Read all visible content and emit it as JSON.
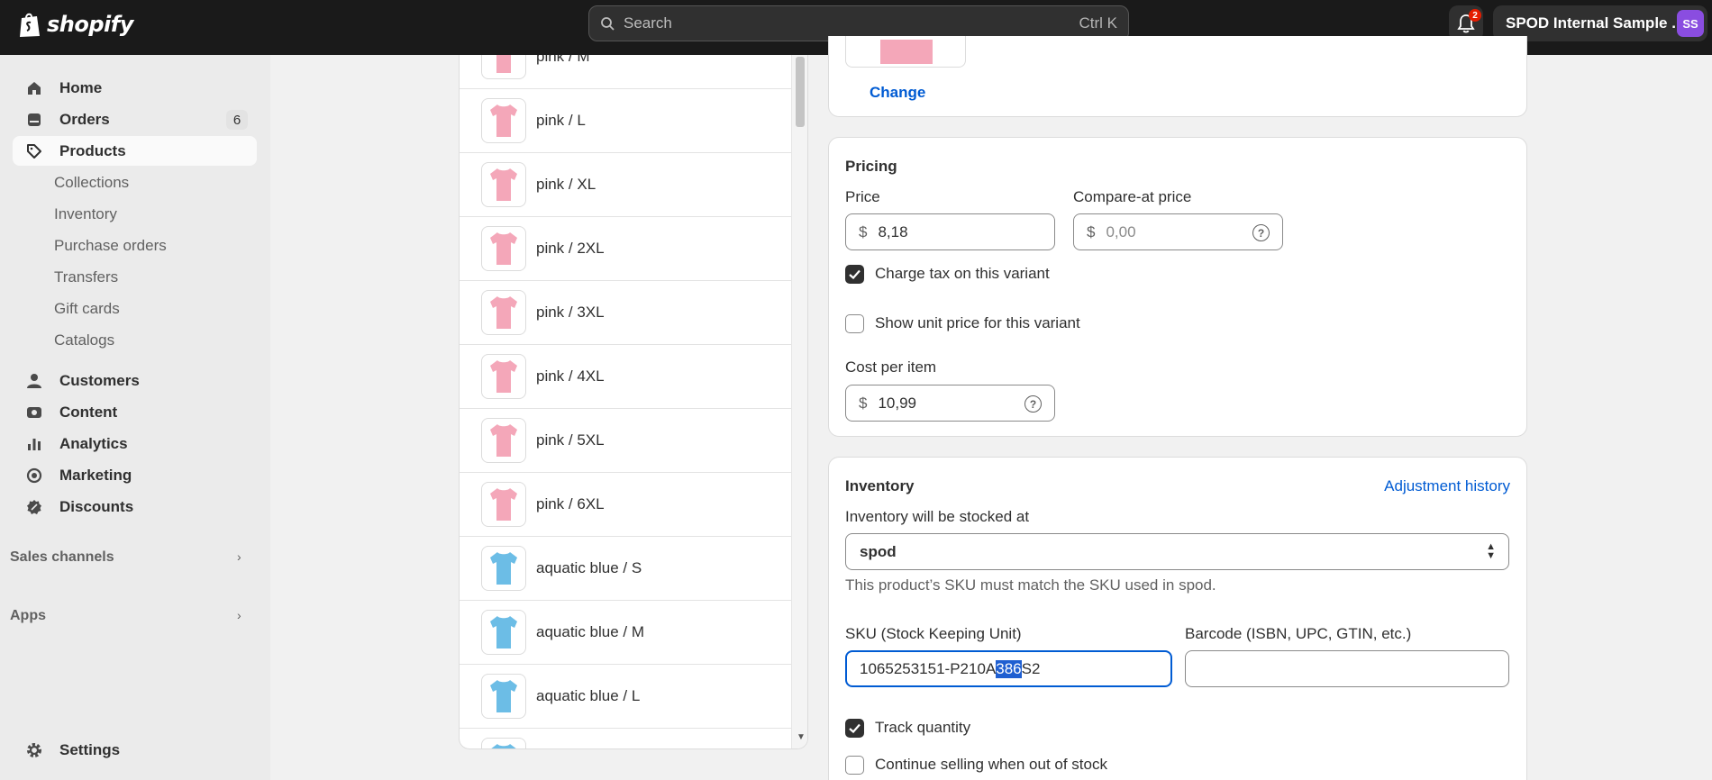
{
  "topbar": {
    "logo_text": "shopify",
    "search_placeholder": "Search",
    "search_shortcut": "Ctrl K",
    "notification_count": "2",
    "store_name": "SPOD Internal Sample ...",
    "avatar_initials": "SS"
  },
  "sidebar": {
    "home": "Home",
    "orders": "Orders",
    "orders_count": "6",
    "products": "Products",
    "sub": [
      "Collections",
      "Inventory",
      "Purchase orders",
      "Transfers",
      "Gift cards",
      "Catalogs"
    ],
    "customers": "Customers",
    "content": "Content",
    "analytics": "Analytics",
    "marketing": "Marketing",
    "discounts": "Discounts",
    "sales_channels": "Sales channels",
    "apps": "Apps",
    "settings": "Settings"
  },
  "variants": [
    {
      "label": "pink / M",
      "color": "#f4a7b9"
    },
    {
      "label": "pink / L",
      "color": "#f4a7b9"
    },
    {
      "label": "pink / XL",
      "color": "#f4a7b9"
    },
    {
      "label": "pink / 2XL",
      "color": "#f4a7b9"
    },
    {
      "label": "pink / 3XL",
      "color": "#f4a7b9"
    },
    {
      "label": "pink / 4XL",
      "color": "#f4a7b9"
    },
    {
      "label": "pink / 5XL",
      "color": "#f4a7b9"
    },
    {
      "label": "pink / 6XL",
      "color": "#f4a7b9"
    },
    {
      "label": "aquatic blue / S",
      "color": "#6cbde6"
    },
    {
      "label": "aquatic blue / M",
      "color": "#6cbde6"
    },
    {
      "label": "aquatic blue / L",
      "color": "#6cbde6"
    },
    {
      "label": "",
      "color": "#6cbde6"
    }
  ],
  "image_card": {
    "change_link": "Change"
  },
  "pricing": {
    "title": "Pricing",
    "price_label": "Price",
    "price_currency": "$",
    "price_value": "8,18",
    "compare_label": "Compare-at price",
    "compare_currency": "$",
    "compare_value": "0,00",
    "charge_tax_label": "Charge tax on this variant",
    "charge_tax_checked": true,
    "unit_price_label": "Show unit price for this variant",
    "unit_price_checked": false,
    "cost_label": "Cost per item",
    "cost_currency": "$",
    "cost_value": "10,99"
  },
  "inventory": {
    "title": "Inventory",
    "history_link": "Adjustment history",
    "stocked_label": "Inventory will be stocked at",
    "location": "spod",
    "sku_hint": "This product’s SKU must match the SKU used in spod.",
    "sku_label": "SKU (Stock Keeping Unit)",
    "sku_before": "1065253151-P210A",
    "sku_selected": "386",
    "sku_after": "S2",
    "barcode_label": "Barcode (ISBN, UPC, GTIN, etc.)",
    "barcode_value": "",
    "track_label": "Track quantity",
    "track_checked": true,
    "continue_label": "Continue selling when out of stock",
    "continue_checked": false
  },
  "colors": {
    "accent": "#005bd3",
    "topbar": "#1a1a1a",
    "badge": "#e51c00",
    "avatar": "#8a4de0"
  }
}
